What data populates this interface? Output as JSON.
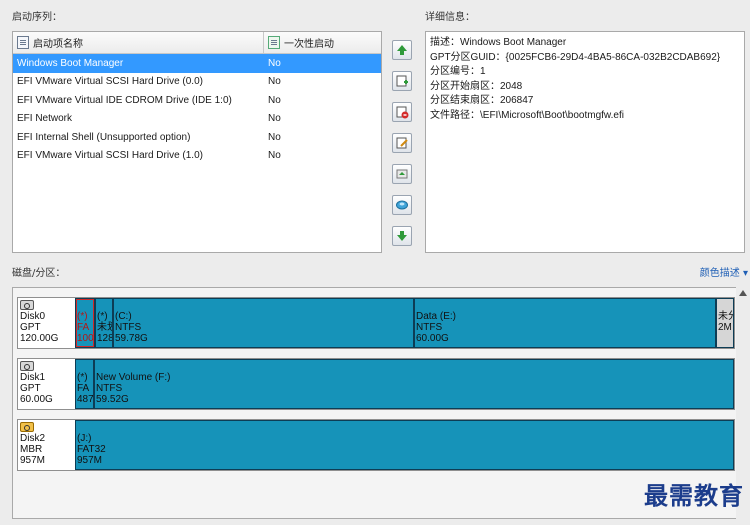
{
  "boot_section_label": "启动序列：",
  "details_section_label": "详细信息：",
  "disk_section_label": "磁盘/分区：",
  "color_legend_label": "颜色描述 ▾",
  "boot_list": {
    "columns": {
      "name": "启动项名称",
      "once": "一次性启动"
    },
    "rows": [
      {
        "name": "Windows Boot Manager",
        "once": "No",
        "selected": true
      },
      {
        "name": "EFI VMware Virtual SCSI Hard Drive (0.0)",
        "once": "No",
        "selected": false
      },
      {
        "name": "EFI VMware Virtual IDE CDROM Drive (IDE 1:0)",
        "once": "No",
        "selected": false
      },
      {
        "name": "EFI Network",
        "once": "No",
        "selected": false
      },
      {
        "name": "EFI Internal Shell (Unsupported option)",
        "once": "No",
        "selected": false
      },
      {
        "name": "EFI VMware Virtual SCSI Hard Drive (1.0)",
        "once": "No",
        "selected": false
      }
    ]
  },
  "side_buttons": [
    {
      "name": "move-up-icon"
    },
    {
      "name": "add-entry-icon"
    },
    {
      "name": "delete-entry-icon"
    },
    {
      "name": "edit-entry-icon"
    },
    {
      "name": "backup-icon"
    },
    {
      "name": "restore-icon"
    },
    {
      "name": "move-down-icon"
    }
  ],
  "details": {
    "lines": [
      "描述：Windows Boot Manager",
      "GPT分区GUID：{0025FCB6-29D4-4BA5-86CA-032B2CDAB692}",
      "分区编号：1",
      "分区开始扇区：2048",
      "分区结束扇区：206847",
      "文件路径：\\EFI\\Microsoft\\Boot\\bootmgfw.efi"
    ]
  },
  "disks": [
    {
      "label": "Disk0",
      "type": "GPT",
      "size": "120.00G",
      "icon": "disk-icon",
      "partitions": [
        {
          "name": "(*)",
          "fs": "FA",
          "size": "100",
          "highlight": true
        },
        {
          "name": "(*)",
          "fs": "未划",
          "size": "128",
          "highlight": false
        },
        {
          "name": "(C:)",
          "fs": "NTFS",
          "size": "59.78G",
          "highlight": false
        },
        {
          "name": "Data (E:)",
          "fs": "NTFS",
          "size": "60.00G",
          "highlight": false
        },
        {
          "name": "未分",
          "fs": "",
          "size": "2M",
          "highlight": false
        }
      ]
    },
    {
      "label": "Disk1",
      "type": "GPT",
      "size": "60.00G",
      "icon": "disk-icon",
      "partitions": [
        {
          "name": "(*)",
          "fs": "FA",
          "size": "487",
          "highlight": false
        },
        {
          "name": "New Volume (F:)",
          "fs": "NTFS",
          "size": "59.52G",
          "highlight": false
        }
      ]
    },
    {
      "label": "Disk2",
      "type": "MBR",
      "size": "957M",
      "icon": "usb-disk-icon",
      "partitions": [
        {
          "name": "(J:)",
          "fs": "FAT32",
          "size": "957M",
          "highlight": false
        }
      ]
    }
  ],
  "colors": {
    "partition": "#1693b9",
    "selected_row": "#3399ff",
    "legend_link": "#1f5fb5"
  },
  "watermark": "最需教育"
}
